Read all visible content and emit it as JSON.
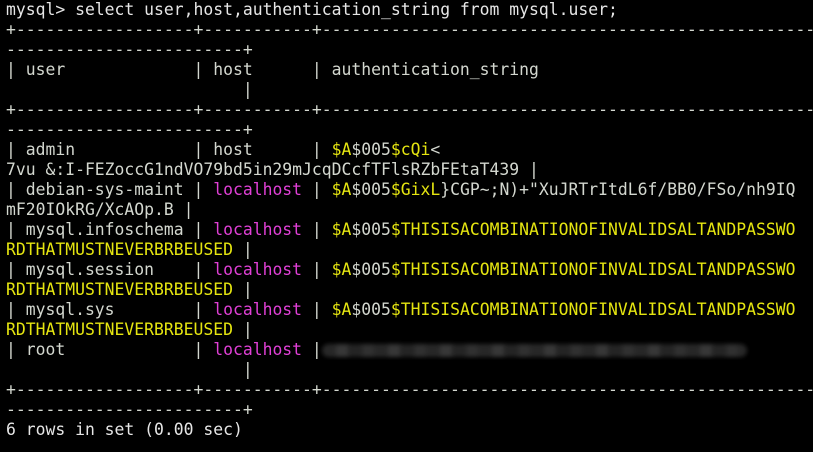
{
  "colors": {
    "background": "#000000",
    "text": "#d3d7cf",
    "magenta": "#e040d6",
    "yellow": "#e5e510"
  },
  "terminal": {
    "lines": [
      [
        {
          "t": "mysql> select user,host,authentication_string from mysql.user;",
          "c": "white"
        }
      ],
      [
        {
          "t": "+------------------+-----------+------------------------------------------------------------",
          "c": ""
        }
      ],
      [
        {
          "t": "------------------------+",
          "c": ""
        }
      ],
      [
        {
          "t": "| user             | host      | authentication_string",
          "c": ""
        }
      ],
      [
        {
          "t": "                        |",
          "c": ""
        }
      ],
      [
        {
          "t": "+------------------+-----------+------------------------------------------------------------",
          "c": ""
        }
      ],
      [
        {
          "t": "------------------------+",
          "c": ""
        }
      ],
      [
        {
          "t": "| admin            | host      | ",
          "c": ""
        },
        {
          "t": "$A",
          "c": "yel"
        },
        {
          "t": "$005",
          "c": ""
        },
        {
          "t": "$cQi",
          "c": "yel"
        },
        {
          "t": "<",
          "c": ""
        }
      ],
      [
        {
          "t": "7vu &:I-FEZoccG1ndVO79bd5in29mJcqDCcfTFlsRZbFEtaT439 |",
          "c": ""
        }
      ],
      [
        {
          "t": "| debian-sys-maint | ",
          "c": ""
        },
        {
          "t": "localhost",
          "c": "mag"
        },
        {
          "t": " | ",
          "c": ""
        },
        {
          "t": "$A",
          "c": "yel"
        },
        {
          "t": "$005",
          "c": ""
        },
        {
          "t": "$GixL",
          "c": "yel"
        },
        {
          "t": "}CGP~;N)+\"XuJRTrItdL6f/BB0/FSo/nh9IQ",
          "c": ""
        }
      ],
      [
        {
          "t": "mF20IOkRG/XcAOp.B |",
          "c": ""
        }
      ],
      [
        {
          "t": "| mysql.infoschema | ",
          "c": ""
        },
        {
          "t": "localhost",
          "c": "mag"
        },
        {
          "t": " | ",
          "c": ""
        },
        {
          "t": "$A",
          "c": "yel"
        },
        {
          "t": "$005",
          "c": ""
        },
        {
          "t": "$THISISACOMBINATIONOFINVALIDSALTANDPASSWO",
          "c": "yel"
        }
      ],
      [
        {
          "t": "RDTHATMUSTNEVERBRBEUSED",
          "c": "yel"
        },
        {
          "t": " |",
          "c": ""
        }
      ],
      [
        {
          "t": "| mysql.session    | ",
          "c": ""
        },
        {
          "t": "localhost",
          "c": "mag"
        },
        {
          "t": " | ",
          "c": ""
        },
        {
          "t": "$A",
          "c": "yel"
        },
        {
          "t": "$005",
          "c": ""
        },
        {
          "t": "$THISISACOMBINATIONOFINVALIDSALTANDPASSWO",
          "c": "yel"
        }
      ],
      [
        {
          "t": "RDTHATMUSTNEVERBRBEUSED",
          "c": "yel"
        },
        {
          "t": " |",
          "c": ""
        }
      ],
      [
        {
          "t": "| mysql.sys        | ",
          "c": ""
        },
        {
          "t": "localhost",
          "c": "mag"
        },
        {
          "t": " | ",
          "c": ""
        },
        {
          "t": "$A",
          "c": "yel"
        },
        {
          "t": "$005",
          "c": ""
        },
        {
          "t": "$THISISACOMBINATIONOFINVALIDSALTANDPASSWO",
          "c": "yel"
        }
      ],
      [
        {
          "t": "RDTHATMUSTNEVERBRBEUSED",
          "c": "yel"
        },
        {
          "t": " |",
          "c": ""
        }
      ],
      [
        {
          "t": "| root             | ",
          "c": ""
        },
        {
          "t": "localhost",
          "c": "mag"
        },
        {
          "t": " |",
          "c": ""
        },
        {
          "redacted": true
        }
      ],
      [
        {
          "t": "                        |",
          "c": ""
        }
      ],
      [
        {
          "t": "+------------------+-----------+------------------------------------------------------------",
          "c": ""
        }
      ],
      [
        {
          "t": "------------------------+",
          "c": ""
        }
      ],
      [
        {
          "t": "6 rows in set (0.00 sec)",
          "c": "white"
        }
      ]
    ]
  }
}
